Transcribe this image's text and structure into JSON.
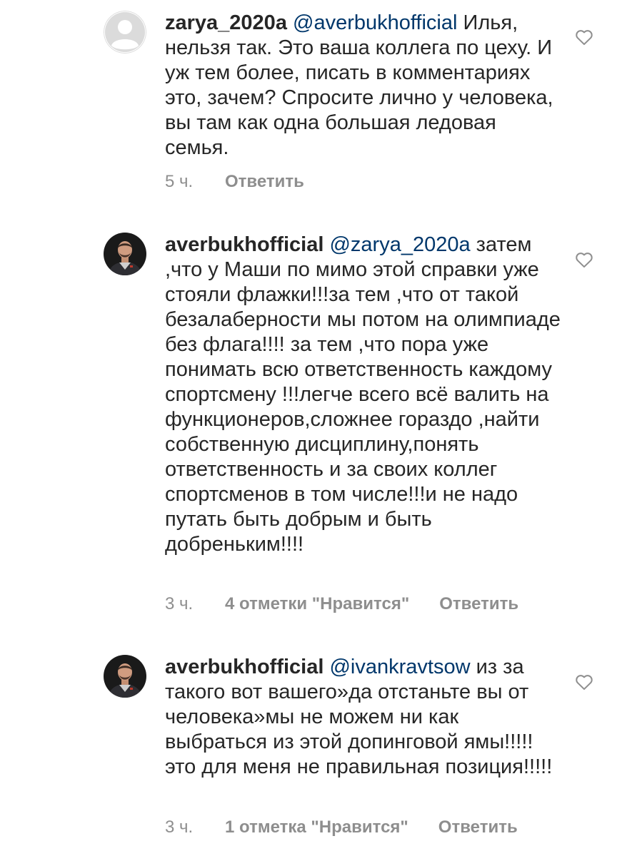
{
  "comments": [
    {
      "username": "zarya_2020a",
      "mention": "@averbukhofficial",
      "text": " Илья, нельзя так. Это ваша коллега по цеху. И уж тем более, писать в комментариях это, зачем? Спросите лично у человека, вы там как одна большая ледовая семья.",
      "time": "5 ч.",
      "likes": "",
      "reply": "Ответить"
    },
    {
      "username": "averbukhofficial",
      "mention": "@zarya_2020a",
      "text": " затем ,что у Маши по мимо этой справки уже стояли флажки!!!за тем ,что от такой безалаберности мы потом на олимпиаде без флага!!!! за тем ,что пора уже понимать всю ответственность каждому спортсмену !!!легче всего всё валить на функционеров,сложнее гораздо ,найти собственную дисциплину,понять ответственность и за своих коллег спортсменов  в том числе!!!и не надо путать быть добрым и быть добреньким!!!!",
      "time": "3 ч.",
      "likes": "4 отметки \"Нравится\"",
      "reply": "Ответить"
    },
    {
      "username": "averbukhofficial",
      "mention": "@ivankravtsow",
      "text": " из за такого вот вашего»да отстаньте вы  от человека»мы не можем ни как выбраться из этой допинговой ямы!!!!!это для меня не правильная позиция!!!!!",
      "time": "3 ч.",
      "likes": "1 отметка \"Нравится\"",
      "reply": "Ответить"
    }
  ],
  "colors": {
    "text": "#262626",
    "mention": "#00376b",
    "meta": "#8e8e8e",
    "placeholder_avatar": "#dbdbdb"
  },
  "icons": {
    "like": "heart-outline-icon",
    "placeholder_avatar": "default-avatar-icon",
    "user_avatar": "user-photo-avatar"
  }
}
